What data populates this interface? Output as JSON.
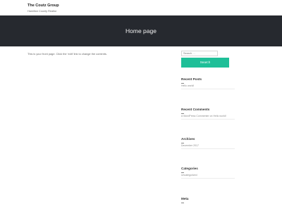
{
  "site": {
    "title": "The Coutz Group",
    "description": "Hamilton County Realtor"
  },
  "hero": {
    "title": "Home page"
  },
  "content": {
    "text": "This is your front page. Click the ‘edit’ link to change the contents."
  },
  "search": {
    "placeholder": "Search …",
    "button_label": "Search"
  },
  "widgets": {
    "recent_posts": {
      "title": "Recent Posts",
      "items": [
        "Hello world!"
      ]
    },
    "recent_comments": {
      "title": "Recent Comments",
      "items": [
        "A WordPress Commenter on Hello world!"
      ]
    },
    "archives": {
      "title": "Archives",
      "items": [
        "December 2017"
      ]
    },
    "categories": {
      "title": "Categories",
      "items": [
        "Uncategorized"
      ]
    },
    "meta": {
      "title": "Meta"
    }
  },
  "colors": {
    "hero_bg": "#26292f",
    "accent": "#1fbf98"
  }
}
